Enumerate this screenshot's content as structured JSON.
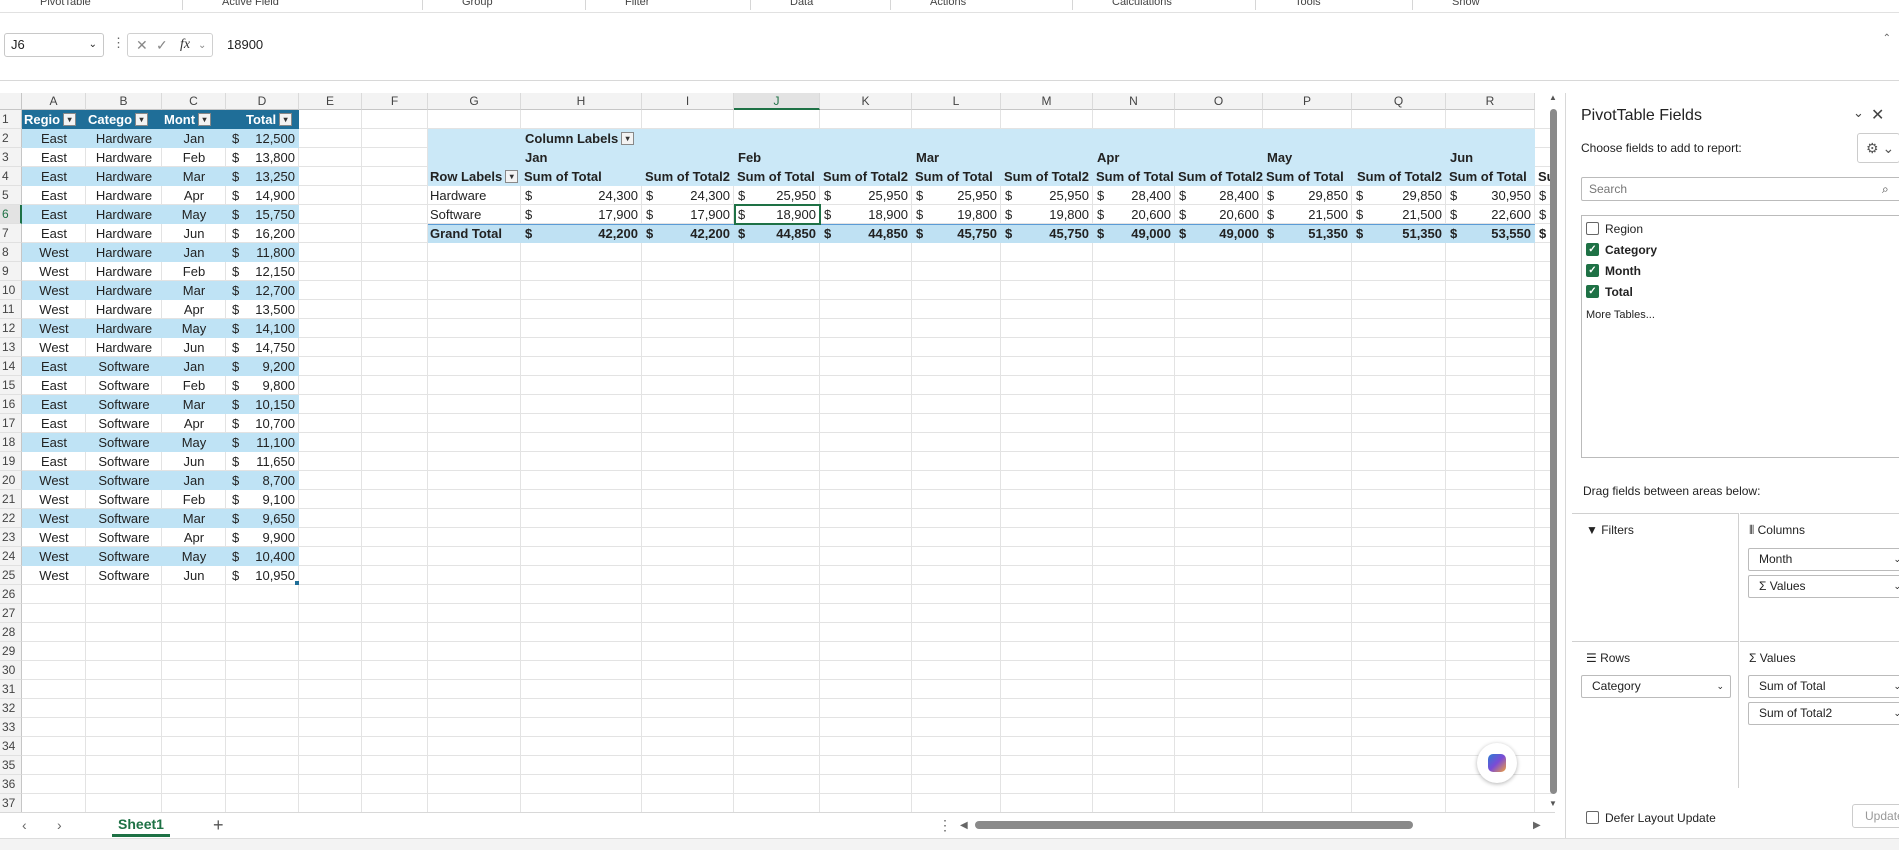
{
  "ribbon": {
    "groups": [
      "PivotTable",
      "Active Field",
      "Group",
      "Filter",
      "Data",
      "Actions",
      "Calculations",
      "Tools",
      "Show"
    ]
  },
  "formula_bar": {
    "name_box": "J6",
    "fx": "fx",
    "value": "18900"
  },
  "columns": [
    "A",
    "B",
    "C",
    "D",
    "E",
    "F",
    "G",
    "H",
    "I",
    "J",
    "K",
    "L",
    "M",
    "N",
    "O",
    "P",
    "Q",
    "R"
  ],
  "rows": [
    "1",
    "2",
    "3",
    "4",
    "5",
    "6",
    "7",
    "8",
    "9",
    "10",
    "11",
    "12",
    "13",
    "14",
    "15",
    "16",
    "17",
    "18",
    "19",
    "20",
    "21",
    "22",
    "23",
    "24",
    "25",
    "26",
    "27",
    "28",
    "29",
    "30",
    "31",
    "32",
    "33",
    "34",
    "35",
    "36",
    "37"
  ],
  "table": {
    "headers": [
      "Regio",
      "Catego",
      "Mont",
      "Total"
    ],
    "currency": "$",
    "rows": [
      [
        "East",
        "Hardware",
        "Jan",
        "12,500"
      ],
      [
        "East",
        "Hardware",
        "Feb",
        "13,800"
      ],
      [
        "East",
        "Hardware",
        "Mar",
        "13,250"
      ],
      [
        "East",
        "Hardware",
        "Apr",
        "14,900"
      ],
      [
        "East",
        "Hardware",
        "May",
        "15,750"
      ],
      [
        "East",
        "Hardware",
        "Jun",
        "16,200"
      ],
      [
        "West",
        "Hardware",
        "Jan",
        "11,800"
      ],
      [
        "West",
        "Hardware",
        "Feb",
        "12,150"
      ],
      [
        "West",
        "Hardware",
        "Mar",
        "12,700"
      ],
      [
        "West",
        "Hardware",
        "Apr",
        "13,500"
      ],
      [
        "West",
        "Hardware",
        "May",
        "14,100"
      ],
      [
        "West",
        "Hardware",
        "Jun",
        "14,750"
      ],
      [
        "East",
        "Software",
        "Jan",
        "9,200"
      ],
      [
        "East",
        "Software",
        "Feb",
        "9,800"
      ],
      [
        "East",
        "Software",
        "Mar",
        "10,150"
      ],
      [
        "East",
        "Software",
        "Apr",
        "10,700"
      ],
      [
        "East",
        "Software",
        "May",
        "11,100"
      ],
      [
        "East",
        "Software",
        "Jun",
        "11,650"
      ],
      [
        "West",
        "Software",
        "Jan",
        "8,700"
      ],
      [
        "West",
        "Software",
        "Feb",
        "9,100"
      ],
      [
        "West",
        "Software",
        "Mar",
        "9,650"
      ],
      [
        "West",
        "Software",
        "Apr",
        "9,900"
      ],
      [
        "West",
        "Software",
        "May",
        "10,400"
      ],
      [
        "West",
        "Software",
        "Jun",
        "10,950"
      ]
    ]
  },
  "pivot": {
    "column_labels": "Column Labels",
    "row_labels": "Row Labels",
    "months": [
      "Jan",
      "Feb",
      "Mar",
      "Apr",
      "May",
      "Jun"
    ],
    "measure_headers": [
      "Sum of Total",
      "Sum of Total2",
      "Sum of Total",
      "Sum of Total2",
      "Sum of Total",
      "Sum of Total2",
      "Sum of Total",
      "Sum of Total2",
      "Sum of Total",
      "Sum of Total2",
      "Sum of Total",
      "Su"
    ],
    "currency": "$",
    "rows": [
      {
        "label": "Hardware",
        "values": [
          "24,300",
          "24,300",
          "25,950",
          "25,950",
          "25,950",
          "25,950",
          "28,400",
          "28,400",
          "29,850",
          "29,850",
          "30,950"
        ]
      },
      {
        "label": "Software",
        "values": [
          "17,900",
          "17,900",
          "18,900",
          "18,900",
          "19,800",
          "19,800",
          "20,600",
          "20,600",
          "21,500",
          "21,500",
          "22,600"
        ]
      },
      {
        "label": "Grand Total",
        "values": [
          "42,200",
          "42,200",
          "44,850",
          "44,850",
          "45,750",
          "45,750",
          "49,000",
          "49,000",
          "51,350",
          "51,350",
          "53,550"
        ]
      }
    ]
  },
  "sheet_tab": "Sheet1",
  "panel": {
    "title": "PivotTable Fields",
    "subtitle": "Choose fields to add to report:",
    "search_placeholder": "Search",
    "fields": [
      {
        "name": "Region",
        "checked": false
      },
      {
        "name": "Category",
        "checked": true
      },
      {
        "name": "Month",
        "checked": true
      },
      {
        "name": "Total",
        "checked": true
      }
    ],
    "more_tables": "More Tables...",
    "drag_label": "Drag fields between areas below:",
    "areas": {
      "filters": "Filters",
      "columns": "Columns",
      "rows": "Rows",
      "values": "Values"
    },
    "columns_items": [
      "Month",
      "Σ Values"
    ],
    "rows_items": [
      "Category"
    ],
    "values_items": [
      "Sum of Total",
      "Sum of Total2"
    ],
    "defer_label": "Defer Layout Update",
    "update_label": "Update"
  }
}
